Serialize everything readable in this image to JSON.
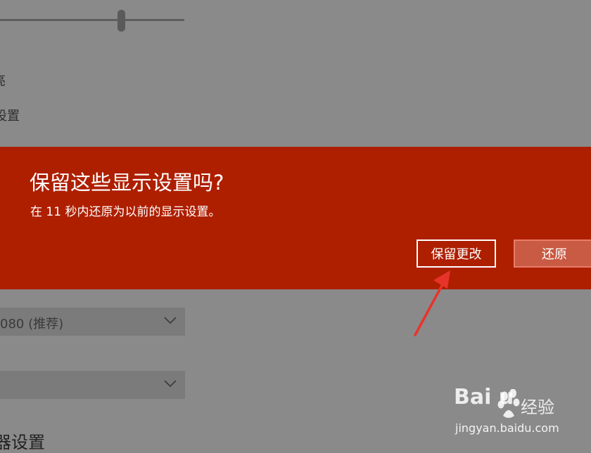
{
  "background": {
    "partial_label_1": "亮",
    "partial_label_2": "设置",
    "dropdown_resolution_value": "080 (推荐)",
    "dropdown_orientation_value": "",
    "section_heading": "器设置"
  },
  "brightness_slider": {
    "level_percent": 66
  },
  "dialog": {
    "title": "保留这些显示设置吗?",
    "message": "在 11 秒内还原为以前的显示设置。",
    "keep_button_label": "保留更改",
    "revert_button_label": "还原",
    "accent_color": "#ae1f00"
  },
  "watermark": {
    "logo_text": "Bai  u",
    "brand_cn": "经验",
    "url": "jingyan.baidu.com"
  },
  "annotation": {
    "arrow_color": "#e8332a"
  }
}
